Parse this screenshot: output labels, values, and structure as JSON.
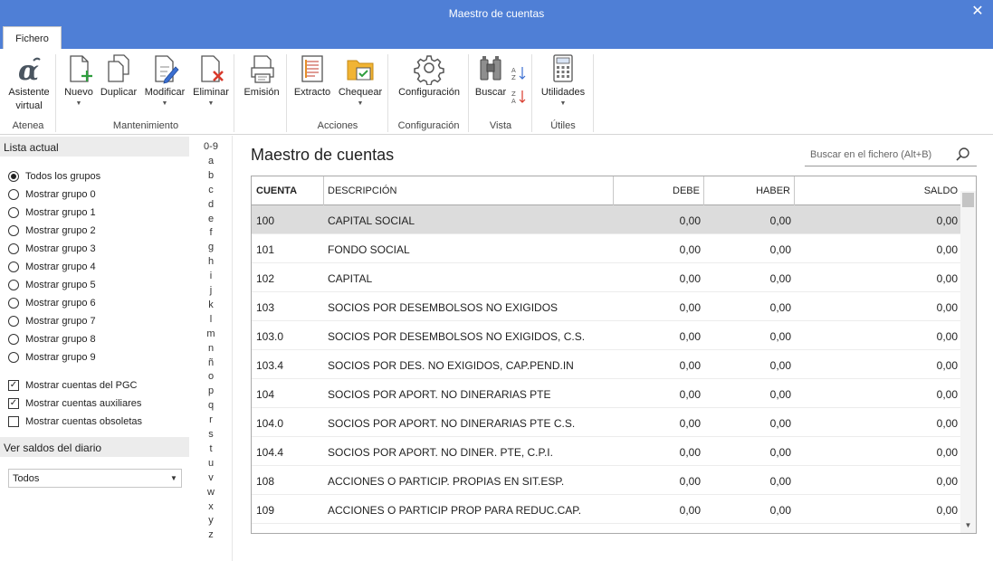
{
  "window": {
    "title": "Maestro de cuentas",
    "close_symbol": "✕"
  },
  "ribbon": {
    "tab": "Fichero",
    "groups": {
      "atenea": "Atenea",
      "mantenimiento": "Mantenimiento",
      "acciones": "Acciones",
      "configuracion": "Configuración",
      "vista": "Vista",
      "utiles": "Útiles"
    },
    "buttons": {
      "asistente_line1": "Asistente",
      "asistente_line2": "virtual",
      "nuevo": "Nuevo",
      "duplicar": "Duplicar",
      "modificar": "Modificar",
      "eliminar": "Eliminar",
      "emision": "Emisión",
      "extracto": "Extracto",
      "chequear": "Chequear",
      "configuracion": "Configuración",
      "buscar": "Buscar",
      "utilidades": "Utilidades"
    },
    "icons": [
      "alpha-icon",
      "new-document-icon",
      "duplicate-icon",
      "edit-icon",
      "delete-icon",
      "print-icon",
      "statement-icon",
      "check-folder-icon",
      "gear-icon",
      "binoculars-icon",
      "sort-az-icon",
      "sort-za-icon",
      "calculator-icon"
    ],
    "colors": {
      "titlebar": "#4f7fd6",
      "green_plus": "#2e9e3e",
      "red_x": "#d83a2c",
      "folder": "#f1b434",
      "pencil": "#3b6fd1"
    }
  },
  "left_panel": {
    "lista_header": "Lista actual",
    "radios": [
      {
        "label": "Todos los grupos",
        "checked": true
      },
      {
        "label": "Mostrar grupo 0",
        "checked": false
      },
      {
        "label": "Mostrar grupo 1",
        "checked": false
      },
      {
        "label": "Mostrar grupo 2",
        "checked": false
      },
      {
        "label": "Mostrar grupo 3",
        "checked": false
      },
      {
        "label": "Mostrar grupo 4",
        "checked": false
      },
      {
        "label": "Mostrar grupo 5",
        "checked": false
      },
      {
        "label": "Mostrar grupo 6",
        "checked": false
      },
      {
        "label": "Mostrar grupo 7",
        "checked": false
      },
      {
        "label": "Mostrar grupo 8",
        "checked": false
      },
      {
        "label": "Mostrar grupo 9",
        "checked": false
      }
    ],
    "checks": [
      {
        "label": "Mostrar cuentas del PGC",
        "checked": true
      },
      {
        "label": "Mostrar cuentas auxiliares",
        "checked": true
      },
      {
        "label": "Mostrar cuentas obsoletas",
        "checked": false
      }
    ],
    "saldos_header": "Ver saldos del diario",
    "saldos_value": "Todos"
  },
  "alphabet": [
    "0-9",
    "a",
    "b",
    "c",
    "d",
    "e",
    "f",
    "g",
    "h",
    "i",
    "j",
    "k",
    "l",
    "m",
    "n",
    "ñ",
    "o",
    "p",
    "q",
    "r",
    "s",
    "t",
    "u",
    "v",
    "w",
    "x",
    "y",
    "z"
  ],
  "main": {
    "title": "Maestro de cuentas",
    "search_placeholder": "Buscar en el fichero (Alt+B)",
    "columns": [
      "CUENTA",
      "DESCRIPCIÓN",
      "DEBE",
      "HABER",
      "SALDO"
    ],
    "rows": [
      {
        "cuenta": "100",
        "descripcion": "CAPITAL SOCIAL",
        "debe": "0,00",
        "haber": "0,00",
        "saldo": "0,00",
        "selected": true
      },
      {
        "cuenta": "101",
        "descripcion": "FONDO SOCIAL",
        "debe": "0,00",
        "haber": "0,00",
        "saldo": "0,00"
      },
      {
        "cuenta": "102",
        "descripcion": "CAPITAL",
        "debe": "0,00",
        "haber": "0,00",
        "saldo": "0,00"
      },
      {
        "cuenta": "103",
        "descripcion": "SOCIOS POR DESEMBOLSOS NO EXIGIDOS",
        "debe": "0,00",
        "haber": "0,00",
        "saldo": "0,00"
      },
      {
        "cuenta": "103.0",
        "descripcion": "SOCIOS POR DESEMBOLSOS NO EXIGIDOS, C.S.",
        "debe": "0,00",
        "haber": "0,00",
        "saldo": "0,00"
      },
      {
        "cuenta": "103.4",
        "descripcion": "SOCIOS POR DES. NO EXIGIDOS, CAP.PEND.IN",
        "debe": "0,00",
        "haber": "0,00",
        "saldo": "0,00"
      },
      {
        "cuenta": "104",
        "descripcion": "SOCIOS POR APORT. NO DINERARIAS PTE",
        "debe": "0,00",
        "haber": "0,00",
        "saldo": "0,00"
      },
      {
        "cuenta": "104.0",
        "descripcion": "SOCIOS POR APORT. NO DINERARIAS PTE C.S.",
        "debe": "0,00",
        "haber": "0,00",
        "saldo": "0,00"
      },
      {
        "cuenta": "104.4",
        "descripcion": "SOCIOS POR APORT. NO DINER. PTE, C.P.I.",
        "debe": "0,00",
        "haber": "0,00",
        "saldo": "0,00"
      },
      {
        "cuenta": "108",
        "descripcion": "ACCIONES O PARTICIP. PROPIAS EN SIT.ESP.",
        "debe": "0,00",
        "haber": "0,00",
        "saldo": "0,00"
      },
      {
        "cuenta": "109",
        "descripcion": "ACCIONES O PARTICIP PROP PARA REDUC.CAP.",
        "debe": "0,00",
        "haber": "0,00",
        "saldo": "0,00"
      }
    ]
  }
}
